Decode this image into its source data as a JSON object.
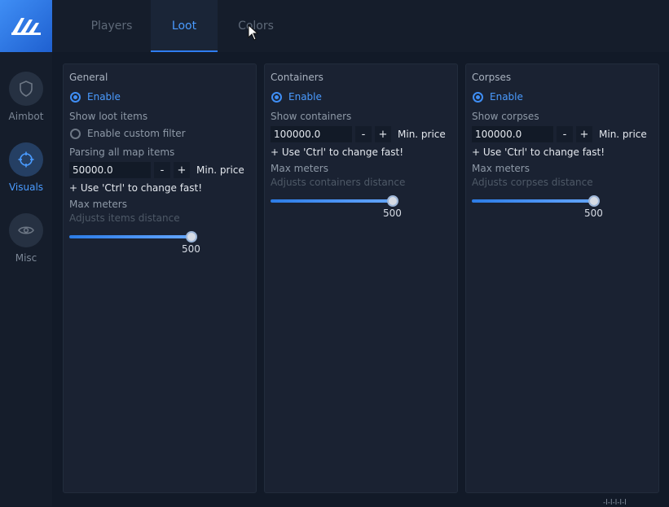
{
  "sidebar": {
    "items": [
      {
        "label": "Aimbot",
        "icon": "shield-icon"
      },
      {
        "label": "Visuals",
        "icon": "crosshair-icon"
      },
      {
        "label": "Misc",
        "icon": "eye-icon"
      }
    ]
  },
  "tabs": [
    {
      "label": "Players"
    },
    {
      "label": "Loot"
    },
    {
      "label": "Colors"
    }
  ],
  "panels": {
    "general": {
      "title": "General",
      "enable_label": "Enable",
      "show_label": "Show loot items",
      "filter_label": "Enable custom filter",
      "parsing_label": "Parsing all map items",
      "price_value": "50000.0",
      "minus": "-",
      "plus": "+",
      "price_label": "Min. price",
      "hint": "+ Use 'Ctrl' to change fast!",
      "meters_label": "Max meters",
      "distance_label": "Adjusts items distance",
      "slider_value": "500"
    },
    "containers": {
      "title": "Containers",
      "enable_label": "Enable",
      "show_label": "Show containers",
      "price_value": "100000.0",
      "minus": "-",
      "plus": "+",
      "price_label": "Min. price",
      "hint": "+ Use 'Ctrl' to change fast!",
      "meters_label": "Max meters",
      "distance_label": "Adjusts containers distance",
      "slider_value": "500"
    },
    "corpses": {
      "title": "Corpses",
      "enable_label": "Enable",
      "show_label": "Show corpses",
      "price_value": "100000.0",
      "minus": "-",
      "plus": "+",
      "price_label": "Min. price",
      "hint": "+ Use 'Ctrl' to change fast!",
      "meters_label": "Max meters",
      "distance_label": "Adjusts corpses distance",
      "slider_value": "500"
    }
  },
  "footer": {
    "text": "-l-l-l-l-l"
  },
  "colors": {
    "accent": "#3f8ef5",
    "background": "#121a28",
    "panel": "#1a2232"
  }
}
